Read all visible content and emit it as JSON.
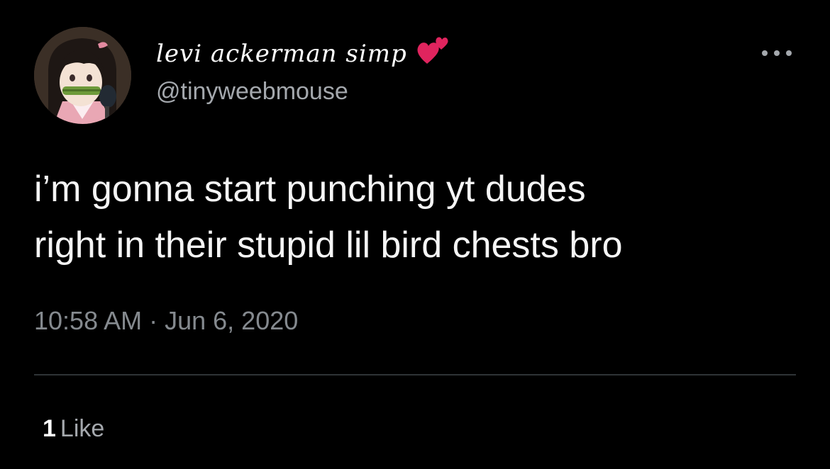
{
  "tweet": {
    "author": {
      "display_name": "levi ackerman simp",
      "name_emoji": "two-hearts-icon",
      "handle": "@tinyweebmouse",
      "avatar": "avatar"
    },
    "text": "i’m gonna start punching yt dudes\nright in their stupid lil bird chests bro",
    "timestamp": "10:58 AM · Jun 6, 2020",
    "stats": {
      "like_count": "1",
      "like_label": "Like"
    },
    "more_icon": "more-options-icon"
  },
  "colors": {
    "background": "#000000",
    "text_primary": "#f5f5f5",
    "text_secondary": "#a4a8ad",
    "timestamp": "#858a8f",
    "divider": "#2f3336",
    "heart": "#e0245e"
  }
}
